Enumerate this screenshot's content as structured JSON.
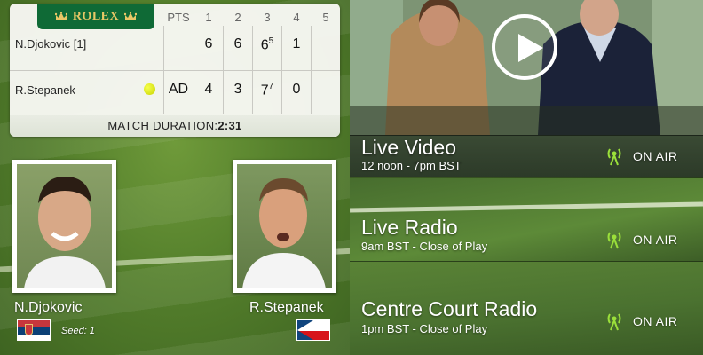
{
  "scoreboard": {
    "sponsor": "ROLEX",
    "headers": [
      "PTS",
      "1",
      "2",
      "3",
      "4",
      "5"
    ],
    "players": [
      {
        "name": "N.Djokovic [1]",
        "pts": "",
        "sets": [
          "6",
          "6",
          "6",
          "1",
          ""
        ],
        "tiebreak": [
          "",
          "",
          "5",
          "",
          ""
        ]
      },
      {
        "name": "R.Stepanek",
        "pts": "AD",
        "sets": [
          "4",
          "3",
          "7",
          "0",
          ""
        ],
        "tiebreak": [
          "",
          "",
          "7",
          "",
          ""
        ]
      }
    ],
    "duration_label": "MATCH DURATION:",
    "duration_value": "2:31"
  },
  "player_cards": {
    "left": {
      "name": "N.Djokovic",
      "seed": "Seed: 1",
      "flag": "serbia-flag"
    },
    "right": {
      "name": "R.Stepanek",
      "flag": "czech-flag"
    }
  },
  "feeds": [
    {
      "title": "Live Video",
      "time": "12 noon - 7pm BST",
      "status": "ON AIR"
    },
    {
      "title": "Live Radio",
      "time": "9am BST - Close of Play",
      "status": "ON AIR"
    },
    {
      "title": "Centre Court Radio",
      "time": "1pm BST - Close of Play",
      "status": "ON AIR"
    }
  ],
  "colors": {
    "rolex_green": "#0f6a36",
    "rolex_gold": "#e8c766",
    "onair_green": "#9be03a"
  }
}
